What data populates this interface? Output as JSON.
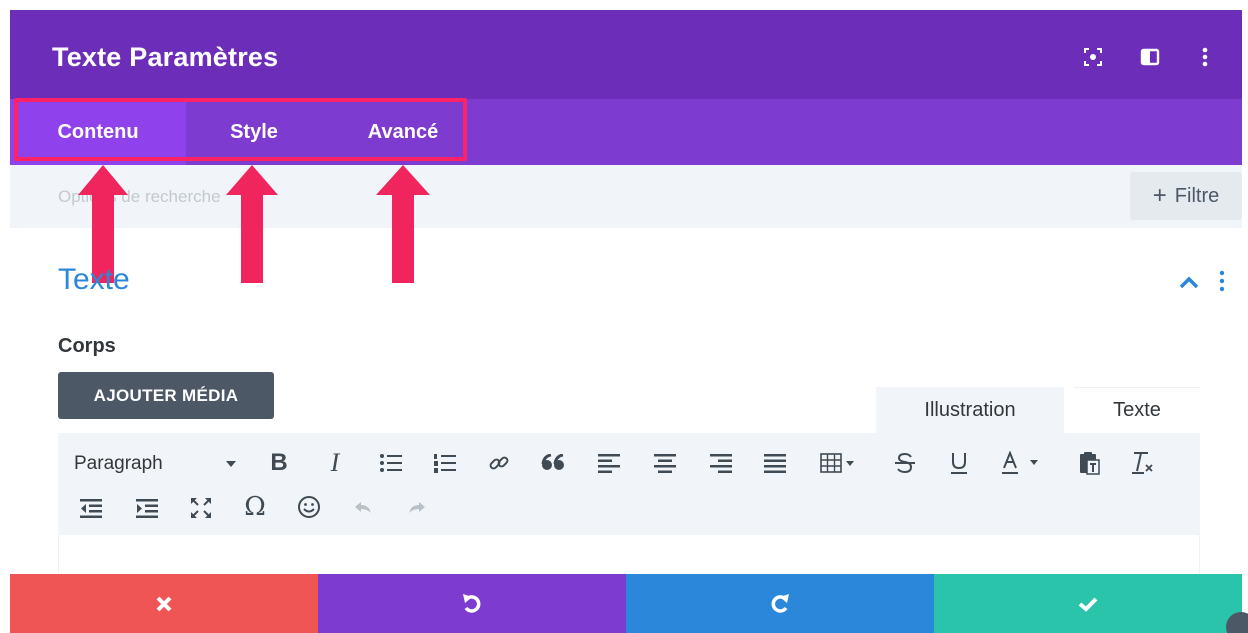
{
  "header": {
    "title": "Texte Paramètres",
    "icons": [
      "focus-icon",
      "split-view-icon",
      "more-vertical-icon"
    ]
  },
  "tabs": [
    {
      "label": "Contenu",
      "active": true
    },
    {
      "label": "Style",
      "active": false
    },
    {
      "label": "Avancé",
      "active": false
    }
  ],
  "search": {
    "placeholder": "Options de recherche"
  },
  "filter": {
    "plus": "+",
    "label": "Filtre"
  },
  "section": {
    "title": "Texte",
    "field_label": "Corps",
    "add_media_label": "AJOUTER MÉDIA"
  },
  "editor": {
    "tabs": [
      {
        "label": "Illustration",
        "active": true
      },
      {
        "label": "Texte",
        "active": false
      }
    ],
    "format_select": "Paragraph",
    "toolbar_icons_row1": [
      "dropdown-caret-icon",
      "bold-icon",
      "italic-icon",
      "bullet-list-icon",
      "numbered-list-icon",
      "link-icon",
      "blockquote-icon",
      "align-left-icon",
      "align-center-icon",
      "align-right-icon",
      "align-justify-icon",
      "table-icon",
      "strikethrough-icon",
      "underline-icon",
      "text-color-icon",
      "paste-text-icon",
      "clear-formatting-icon"
    ],
    "toolbar_icons_row2": [
      "outdent-icon",
      "indent-icon",
      "fullscreen-icon",
      "special-character-icon",
      "emoji-icon",
      "undo-icon",
      "redo-icon"
    ],
    "glyphs": {
      "bold": "B",
      "italic": "I",
      "omega": "Ω",
      "emoji": "☺"
    }
  },
  "footer": [
    {
      "name": "close-icon",
      "color": "#ef5555"
    },
    {
      "name": "undo-icon",
      "color": "#7e3bd0"
    },
    {
      "name": "redo-icon",
      "color": "#2b87da"
    },
    {
      "name": "check-icon",
      "color": "#29c4a9"
    }
  ],
  "colors": {
    "header_bg": "#6c2eb9",
    "tabbar_bg": "#7e3bd0",
    "active_tab_bg": "#8f42ec",
    "highlight": "#ff2266",
    "arrow": "#f0255e",
    "section_title": "#2b87da"
  }
}
